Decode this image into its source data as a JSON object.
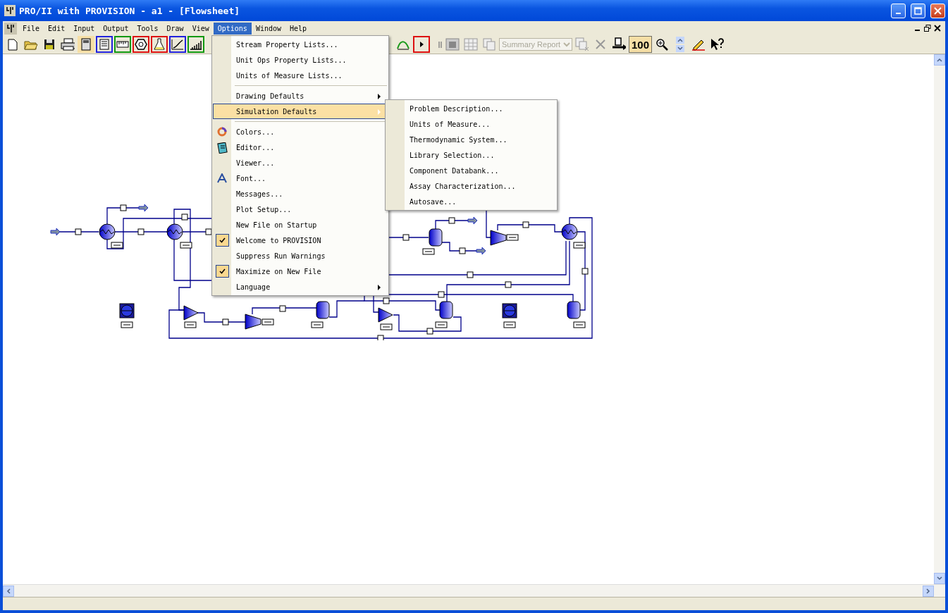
{
  "window": {
    "title": "PRO/II with PROVISION - a1 - [Flowsheet]"
  },
  "menubar": [
    {
      "label": "File",
      "selected": false
    },
    {
      "label": "Edit",
      "selected": false
    },
    {
      "label": "Input",
      "selected": false
    },
    {
      "label": "Output",
      "selected": false
    },
    {
      "label": "Tools",
      "selected": false
    },
    {
      "label": "Draw",
      "selected": false
    },
    {
      "label": "View",
      "selected": false
    },
    {
      "label": "Options",
      "selected": true
    },
    {
      "label": "Window",
      "selected": false
    },
    {
      "label": "Help",
      "selected": false
    }
  ],
  "toolbar": {
    "report_combo": {
      "value": "Summary Report",
      "disabled": true
    },
    "zoom_label": "100"
  },
  "options_menu": [
    {
      "kind": "item",
      "label": "Stream Property Lists...",
      "checked": false,
      "submenu": false,
      "selected": false
    },
    {
      "kind": "item",
      "label": "Unit Ops Property Lists...",
      "checked": false,
      "submenu": false,
      "selected": false
    },
    {
      "kind": "item",
      "label": "Units of Measure Lists...",
      "checked": false,
      "submenu": false,
      "selected": false
    },
    {
      "kind": "separator"
    },
    {
      "kind": "item",
      "label": "Drawing Defaults",
      "checked": false,
      "submenu": true,
      "selected": false
    },
    {
      "kind": "item",
      "label": "Simulation Defaults",
      "checked": false,
      "submenu": true,
      "selected": true
    },
    {
      "kind": "separator"
    },
    {
      "kind": "item",
      "label": "Colors...",
      "checked": false,
      "submenu": false,
      "selected": false
    },
    {
      "kind": "item",
      "label": "Editor...",
      "checked": false,
      "submenu": false,
      "selected": false
    },
    {
      "kind": "item",
      "label": "Viewer...",
      "checked": false,
      "submenu": false,
      "selected": false
    },
    {
      "kind": "item",
      "label": "Font...",
      "checked": false,
      "submenu": false,
      "selected": false
    },
    {
      "kind": "item",
      "label": "Messages...",
      "checked": false,
      "submenu": false,
      "selected": false
    },
    {
      "kind": "item",
      "label": "Plot Setup...",
      "checked": false,
      "submenu": false,
      "selected": false
    },
    {
      "kind": "item",
      "label": "New File on Startup",
      "checked": false,
      "submenu": false,
      "selected": false
    },
    {
      "kind": "item",
      "label": "Welcome to PROVISION",
      "checked": true,
      "submenu": false,
      "selected": false
    },
    {
      "kind": "item",
      "label": "Suppress Run Warnings",
      "checked": false,
      "submenu": false,
      "selected": false
    },
    {
      "kind": "item",
      "label": "Maximize on New File",
      "checked": true,
      "submenu": false,
      "selected": false
    },
    {
      "kind": "item",
      "label": "Language",
      "checked": false,
      "submenu": true,
      "selected": false
    }
  ],
  "simulation_defaults_submenu": [
    "Problem Description...",
    "Units of Measure...",
    "Thermodynamic System...",
    "Library Selection...",
    "Component Databank...",
    "Assay Characterization...",
    "Autosave..."
  ]
}
